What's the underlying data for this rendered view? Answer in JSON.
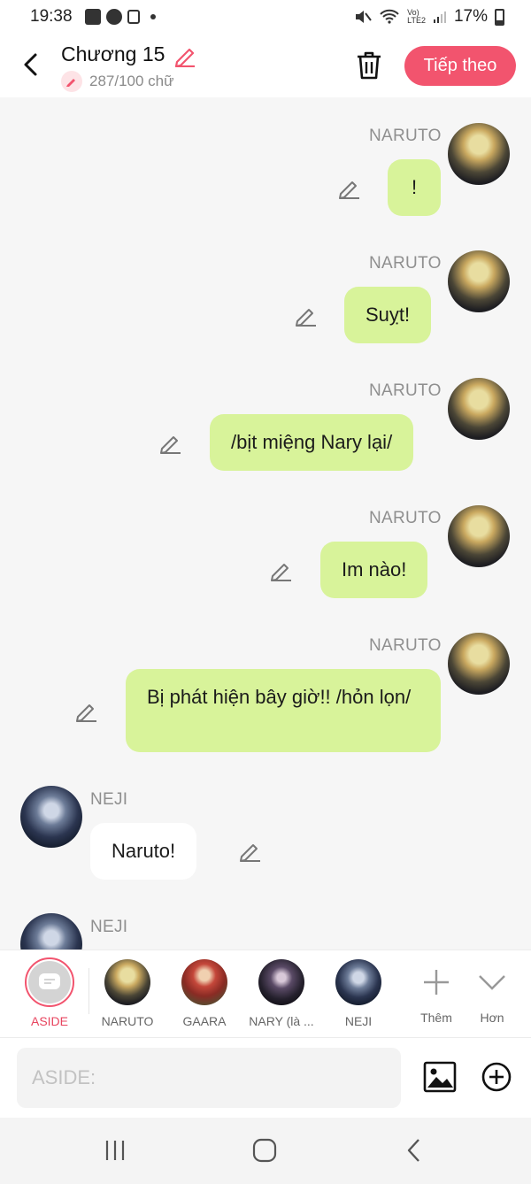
{
  "status_bar": {
    "time": "19:38",
    "battery": "17%"
  },
  "header": {
    "title": "Chương 15",
    "word_count": "287/100 chữ",
    "next_button": "Tiếp theo"
  },
  "messages": [
    {
      "speaker": "NARUTO",
      "text": "!",
      "side": "right"
    },
    {
      "speaker": "NARUTO",
      "text": "Suỵt!",
      "side": "right"
    },
    {
      "speaker": "NARUTO",
      "text": "/bịt miệng Nary lại/",
      "side": "right"
    },
    {
      "speaker": "NARUTO",
      "text": "Im nào!",
      "side": "right"
    },
    {
      "speaker": "NARUTO",
      "text": "Bị phát hiện bây giờ!! /hỏn lọn/",
      "side": "right"
    },
    {
      "speaker": "NEJI",
      "text": "Naruto!",
      "side": "left"
    },
    {
      "speaker": "NEJI",
      "text": "",
      "side": "left"
    }
  ],
  "character_bar": {
    "items": [
      {
        "label": "ASIDE",
        "selected": true
      },
      {
        "label": "NARUTO"
      },
      {
        "label": "GAARA"
      },
      {
        "label": "NARY (là ..."
      },
      {
        "label": "NEJI"
      }
    ],
    "add_label": "Thêm",
    "more_label": "Hơn"
  },
  "composer": {
    "placeholder": "ASIDE:"
  },
  "colors": {
    "accent": "#f2546e",
    "bubble_right": "#d8f39a",
    "bubble_left": "#ffffff",
    "background": "#f6f6f6"
  }
}
